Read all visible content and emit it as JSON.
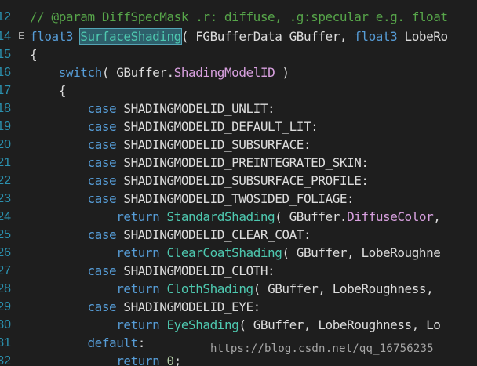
{
  "editor": {
    "lines": [
      {
        "number": "12",
        "tokens": {
          "comment": "// @param DiffSpecMask .r: diffuse, .g:specular e.g. float"
        }
      },
      {
        "number": "14",
        "tokens": {
          "type": "float3",
          "space1": " ",
          "func": "SurfaceShading",
          "rest": "( FGBufferData GBuffer, ",
          "type2": "float3",
          "rest2": " LobeRo"
        }
      },
      {
        "number": "15",
        "tokens": {
          "plain": "{"
        }
      },
      {
        "number": "16",
        "tokens": {
          "indent": "    ",
          "kw": "switch",
          "rest": "( GBuffer.",
          "member": "ShadingModelID",
          "rest2": " )"
        }
      },
      {
        "number": "17",
        "tokens": {
          "plain": "    {"
        }
      },
      {
        "number": "18",
        "tokens": {
          "indent": "        ",
          "kw": "case",
          "rest": " SHADINGMODELID_UNLIT:"
        }
      },
      {
        "number": "19",
        "tokens": {
          "indent": "        ",
          "kw": "case",
          "rest": " SHADINGMODELID_DEFAULT_LIT:"
        }
      },
      {
        "number": "20",
        "tokens": {
          "indent": "        ",
          "kw": "case",
          "rest": " SHADINGMODELID_SUBSURFACE:"
        }
      },
      {
        "number": "21",
        "tokens": {
          "indent": "        ",
          "kw": "case",
          "rest": " SHADINGMODELID_PREINTEGRATED_SKIN:"
        }
      },
      {
        "number": "22",
        "tokens": {
          "indent": "        ",
          "kw": "case",
          "rest": " SHADINGMODELID_SUBSURFACE_PROFILE:"
        }
      },
      {
        "number": "23",
        "tokens": {
          "indent": "        ",
          "kw": "case",
          "rest": " SHADINGMODELID_TWOSIDED_FOLIAGE:"
        }
      },
      {
        "number": "24",
        "tokens": {
          "indent": "            ",
          "kw": "return",
          "space": " ",
          "func": "StandardShading",
          "rest": "( GBuffer.",
          "member": "DiffuseColor",
          "rest2": ","
        }
      },
      {
        "number": "25",
        "tokens": {
          "indent": "        ",
          "kw": "case",
          "rest": " SHADINGMODELID_CLEAR_COAT:"
        }
      },
      {
        "number": "26",
        "tokens": {
          "indent": "            ",
          "kw": "return",
          "space": " ",
          "func": "ClearCoatShading",
          "rest": "( GBuffer, LobeRoughne"
        }
      },
      {
        "number": "27",
        "tokens": {
          "indent": "        ",
          "kw": "case",
          "rest": " SHADINGMODELID_CLOTH:"
        }
      },
      {
        "number": "28",
        "tokens": {
          "indent": "            ",
          "kw": "return",
          "space": " ",
          "func": "ClothShading",
          "rest": "( GBuffer, LobeRoughness,"
        }
      },
      {
        "number": "29",
        "tokens": {
          "indent": "        ",
          "kw": "case",
          "rest": " SHADINGMODELID_EYE:"
        }
      },
      {
        "number": "30",
        "tokens": {
          "indent": "            ",
          "kw": "return",
          "space": " ",
          "func": "EyeShading",
          "rest": "( GBuffer, LobeRoughness, Lo"
        }
      },
      {
        "number": "31",
        "tokens": {
          "indent": "        ",
          "kw": "default",
          "rest": ":"
        }
      },
      {
        "number": "32",
        "tokens": {
          "indent": "            ",
          "kw": "return",
          "space": " ",
          "num": "0",
          "rest": ";"
        }
      }
    ]
  },
  "watermark": {
    "text": "https://blog.csdn.net/qq_16756235"
  },
  "colors": {
    "background": "#1e1e1e",
    "line_number": "#2b91af",
    "comment": "#57a64a",
    "keyword": "#569cd6",
    "function": "#4ec9b0",
    "member": "#d8a0df",
    "plain": "#dcdcdc",
    "number": "#b5cea8",
    "highlight": "#2e5f6b"
  }
}
